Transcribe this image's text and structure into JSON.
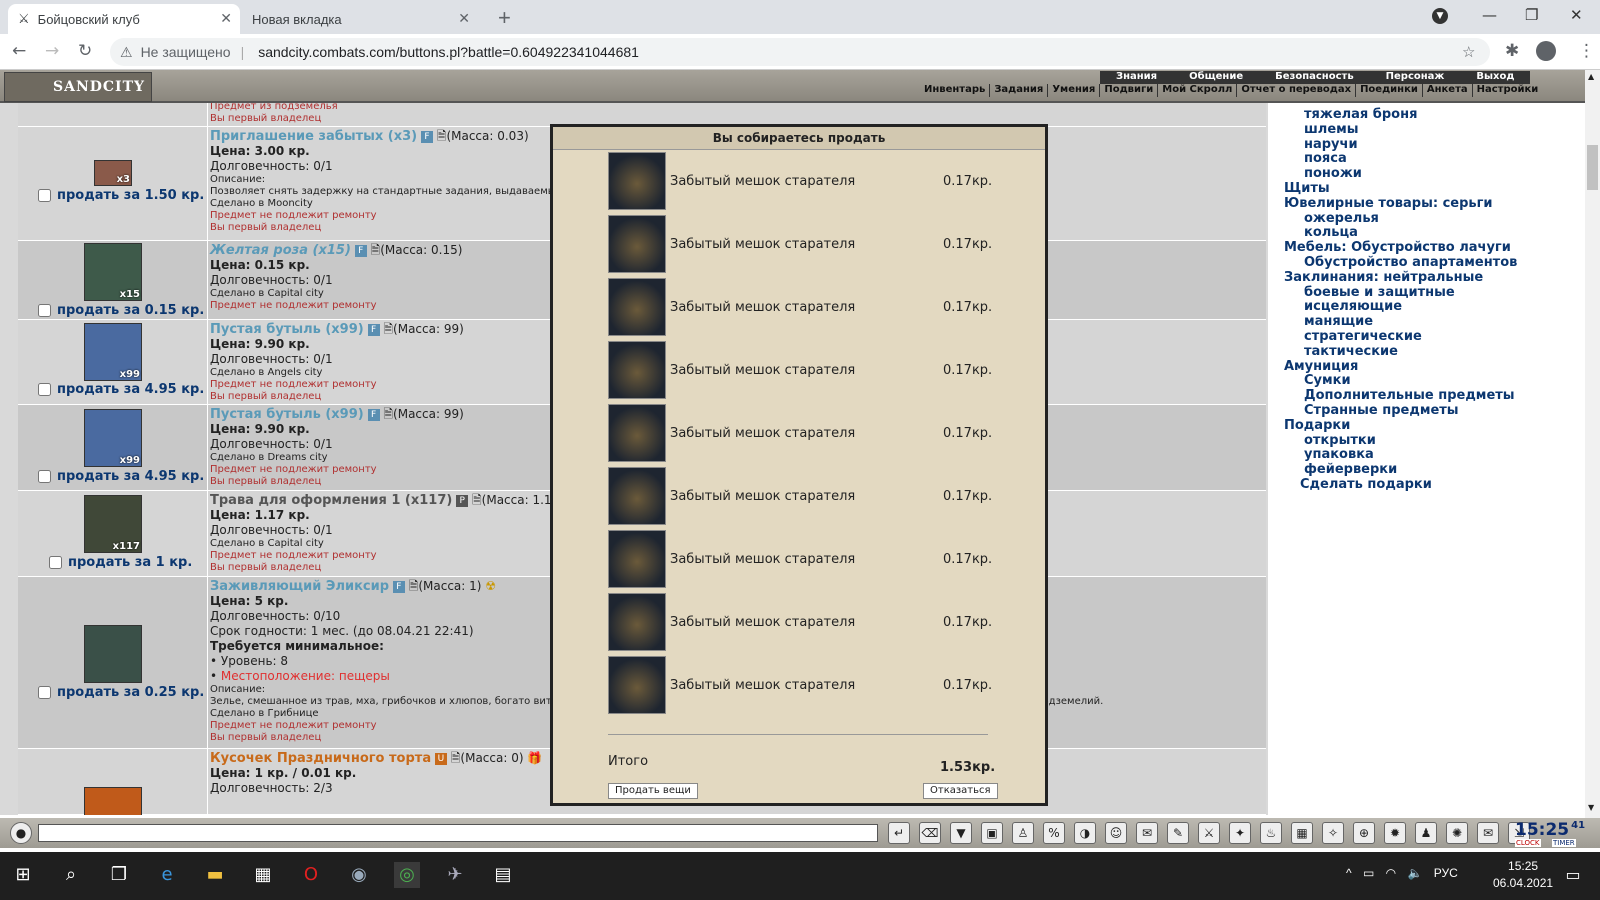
{
  "tabs": [
    {
      "label": "Бойцовский клуб"
    },
    {
      "label": "Новая вкладка"
    }
  ],
  "address": {
    "security": "Не защищено",
    "url": "sandcity.combats.com/buttons.pl?battle=0.604922341044681"
  },
  "game": {
    "logo": "SANDCITY",
    "menu_top": [
      "Знания",
      "Общение",
      "Безопасность",
      "Персонаж",
      "Выход"
    ],
    "menu_bottom": [
      "Инвентарь",
      "Задания",
      "Умения",
      "Подвиги",
      "Мой Скролл",
      "Отчет о переводах",
      "Поединки",
      "Анкета",
      "Настройки"
    ]
  },
  "items": [
    {
      "top_red": "Предмет из подземелья",
      "top_red2": "Вы первый владелец"
    },
    {
      "name": "Приглашение забытых (x3)",
      "badge": "F",
      "mass": "(Масса: 0.03)",
      "price": "Цена: 3.00 кр.",
      "dur": "Долговечность: 0/1",
      "desc_label": "Описание:",
      "desc": "Позволяет снять задержку на стандартные задания, выдаваемые",
      "made": "Сделано в Mooncity",
      "red1": "Предмет не подлежит ремонту",
      "red2": "Вы первый владелец",
      "qty": "x3",
      "sell": "продать за 1.50 кр."
    },
    {
      "name": "Желтая роза (x15)",
      "badge": "F",
      "mass": "(Масса: 0.15)",
      "price": "Цена: 0.15 кр.",
      "dur": "Долговечность: 0/1",
      "made": "Сделано в Capital city",
      "red1": "Предмет не подлежит ремонту",
      "qty": "x15",
      "sell": "продать за 0.15 кр."
    },
    {
      "name": "Пустая бутыль (x99)",
      "badge": "F",
      "mass": "(Масса: 99)",
      "price": "Цена: 9.90 кр.",
      "dur": "Долговечность: 0/1",
      "made": "Сделано в Angels city",
      "red1": "Предмет не подлежит ремонту",
      "red2": "Вы первый владелец",
      "qty": "x99",
      "sell": "продать за 4.95 кр."
    },
    {
      "name": "Пустая бутыль (x99)",
      "badge": "F",
      "mass": "(Масса: 99)",
      "price": "Цена: 9.90 кр.",
      "dur": "Долговечность: 0/1",
      "made": "Сделано в Dreams city",
      "red1": "Предмет не подлежит ремонту",
      "red2": "Вы первый владелец",
      "qty": "x99",
      "sell": "продать за 4.95 кр."
    },
    {
      "name": "Трава для оформления 1 (x117)",
      "badge": "P",
      "mass": "(Масса: 1.1",
      "price": "Цена: 1.17 кр.",
      "dur": "Долговечность: 0/1",
      "made": "Сделано в Capital city",
      "red1": "Предмет не подлежит ремонту",
      "red2": "Вы первый владелец",
      "qty": "x117",
      "sell": "продать за 1 кр."
    },
    {
      "name": "Заживляющий Эликсир",
      "badge": "F",
      "mass": "(Масса: 1)",
      "price": "Цена: 5 кр.",
      "dur": "Долговечность: 0/10",
      "expiry": "Срок годности: 1 мес. (до 08.04.21 22:41)",
      "req": "Требуется минимальное:",
      "level": "• Уровень: 8",
      "location_label": "• ",
      "location": "Местоположение: пещеры",
      "desc_label": "Описание:",
      "desc": "Зелье, смешанное из трав, мха, грибочков и хлюпов, богато вит",
      "desc_tail": "подземелий.",
      "made": "Сделано в Грибнице",
      "red1": "Предмет не подлежит ремонту",
      "red2": "Вы первый владелец",
      "sell": "продать за 0.25 кр."
    },
    {
      "name": "Кусочек Праздничного торта",
      "badge": "U",
      "mass": "(Масса: 0)",
      "price": "Цена: 1 кр. / 0.01 кр.",
      "dur": "Долговечность: 2/3"
    }
  ],
  "categories": [
    {
      "label": "тяжелая броня",
      "indent": 1
    },
    {
      "label": "шлемы",
      "indent": 1
    },
    {
      "label": "наручи",
      "indent": 1
    },
    {
      "label": "пояса",
      "indent": 1
    },
    {
      "label": "поножи",
      "indent": 1
    },
    {
      "label": "Щиты",
      "indent": 0
    },
    {
      "label": "Ювелирные товары: серьги",
      "indent": 0
    },
    {
      "label": "ожерелья",
      "indent": 1
    },
    {
      "label": "кольца",
      "indent": 1
    },
    {
      "label": "Мебель: Обустройство лачуги",
      "indent": 0
    },
    {
      "label": "Обустройство апартаментов",
      "indent": 1
    },
    {
      "label": "Заклинания: нейтральные",
      "indent": 0
    },
    {
      "label": "боевые и защитные",
      "indent": 1
    },
    {
      "label": "исцеляющие",
      "indent": 1
    },
    {
      "label": "манящие",
      "indent": 1
    },
    {
      "label": "стратегические",
      "indent": 1
    },
    {
      "label": "тактические",
      "indent": 1
    },
    {
      "label": "Амуниция",
      "indent": 0
    },
    {
      "label": "Сумки",
      "indent": 1
    },
    {
      "label": "Дополнительные предметы",
      "indent": 1
    },
    {
      "label": "Странные предметы",
      "indent": 1
    },
    {
      "label": "Подарки",
      "indent": 0
    },
    {
      "label": "открытки",
      "indent": 1
    },
    {
      "label": "упаковка",
      "indent": 1
    },
    {
      "label": "фейерверки",
      "indent": 1
    },
    {
      "label": "Сделать подарки",
      "indent": 2
    }
  ],
  "modal": {
    "title": "Вы собираетесь продать",
    "items": [
      {
        "name": "Забытый мешок старателя",
        "price": "0.17кр."
      },
      {
        "name": "Забытый мешок старателя",
        "price": "0.17кр."
      },
      {
        "name": "Забытый мешок старателя",
        "price": "0.17кр."
      },
      {
        "name": "Забытый мешок старателя",
        "price": "0.17кр."
      },
      {
        "name": "Забытый мешок старателя",
        "price": "0.17кр."
      },
      {
        "name": "Забытый мешок старателя",
        "price": "0.17кр."
      },
      {
        "name": "Забытый мешок старателя",
        "price": "0.17кр."
      },
      {
        "name": "Забытый мешок старателя",
        "price": "0.17кр."
      },
      {
        "name": "Забытый мешок старателя",
        "price": "0.17кр."
      }
    ],
    "total_label": "Итого",
    "total": "1.53кр.",
    "sell_button": "Продать вещи",
    "cancel_button": "Отказаться"
  },
  "chat": {
    "clock": "15:25",
    "seconds": "41",
    "clock_label": "CLOCK",
    "timer_label": "TIMER"
  },
  "taskbar": {
    "lang": "РУС",
    "time": "15:25",
    "date": "06.04.2021"
  }
}
